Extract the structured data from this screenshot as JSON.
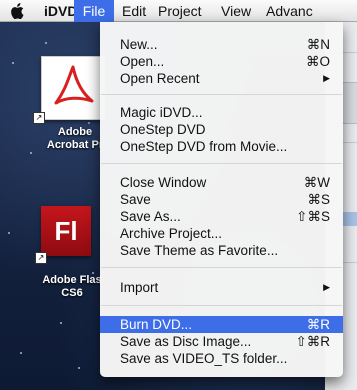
{
  "menubar": {
    "app_name": "iDVD",
    "menus": {
      "file": "File",
      "edit": "Edit",
      "project": "Project",
      "view": "View",
      "advanced": "Advanc"
    },
    "apple_icon": "apple-logo-icon"
  },
  "desktop": {
    "icons": [
      {
        "label_line1": "Adobe",
        "label_line2": "Acrobat Pr",
        "icon": "acrobat-icon"
      },
      {
        "label_line1": "Adobe Flas",
        "label_line2": "CS6",
        "icon": "flash-icon",
        "glyph": "Fl"
      }
    ]
  },
  "file_menu": {
    "items": [
      {
        "label": "New...",
        "shortcut": "⌘N"
      },
      {
        "label": "Open...",
        "shortcut": "⌘O"
      },
      {
        "label": "Open Recent",
        "submenu": "▶"
      },
      {
        "label": "Magic iDVD..."
      },
      {
        "label": "OneStep DVD"
      },
      {
        "label": "OneStep DVD from Movie..."
      },
      {
        "label": "Close Window",
        "shortcut": "⌘W"
      },
      {
        "label": "Save",
        "shortcut": "⌘S"
      },
      {
        "label": "Save As...",
        "shortcut": "⇧⌘S"
      },
      {
        "label": "Archive Project..."
      },
      {
        "label": "Save Theme as Favorite..."
      },
      {
        "label": "Import",
        "submenu": "▶"
      },
      {
        "label": "Burn DVD...",
        "shortcut": "⌘R",
        "highlighted": true
      },
      {
        "label": "Save as Disc Image...",
        "shortcut": "⇧⌘R"
      },
      {
        "label": "Save as VIDEO_TS folder..."
      }
    ]
  },
  "colors": {
    "highlight": "#3d6ee8",
    "flash_red": "#c4161c",
    "acrobat_red": "#d8201f"
  }
}
